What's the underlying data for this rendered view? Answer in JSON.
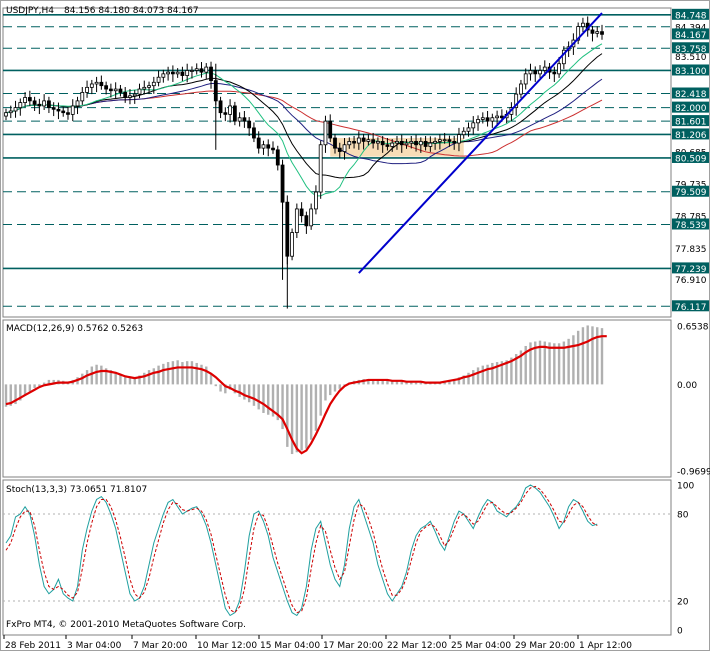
{
  "header": {
    "symbol": "USDJPY,H4",
    "ohlc": "84.156 84.180 84.073 84.167"
  },
  "macd_header": "MACD(12,26,9) 0.5762 0.5263",
  "stoch_header": "Stoch(13,3,3) 73.0651 71.8107",
  "copyright": "FxPro MT4, © 2001-2010 MetaQuotes Software Corp.",
  "colors": {
    "background": "#ffffff",
    "up_candle": "#000000",
    "down_candle": "#000000",
    "trendline": "#0000cc",
    "level_line": "#006060",
    "price_box": "#006060",
    "macd_hist": "#b0b0b0",
    "macd_signal": "#dd0000",
    "stoch_main": "#20a0a0",
    "stoch_signal": "#cc0000",
    "ma_red": "#cc3030",
    "ma_navy": "#202080",
    "ma_black": "#000000",
    "ma_green": "#20c080",
    "fill_zone": "#f5d5a5"
  },
  "chart_data": [
    {
      "type": "candlestick",
      "title": "USDJPY,H4",
      "ylim": [
        75.8,
        84.95
      ],
      "y_ticks": [
        "84.748",
        "84.394",
        "84.167",
        "83.758",
        "83.510",
        "83.100",
        "82.418",
        "82.000",
        "81.601",
        "81.206",
        "80.685",
        "80.509",
        "79.735",
        "79.509",
        "78.785",
        "78.539",
        "77.835",
        "77.239",
        "76.910",
        "76.117"
      ],
      "boxed_ticks": [
        "84.748",
        "84.167",
        "83.758",
        "83.100",
        "82.418",
        "82.000",
        "81.601",
        "81.206",
        "80.509",
        "79.509",
        "78.539",
        "77.239",
        "76.117"
      ],
      "x_ticks": [
        "28 Feb 2011",
        "3 Mar 04:00",
        "7 Mar 20:00",
        "10 Mar 12:00",
        "15 Mar 04:00",
        "17 Mar 20:00",
        "22 Mar 12:00",
        "25 Mar 04:00",
        "29 Mar 20:00",
        "1 Apr 12:00"
      ],
      "levels": [
        {
          "price": 84.748,
          "style": "solid"
        },
        {
          "price": 84.394,
          "style": "dashed"
        },
        {
          "price": 83.758,
          "style": "dashed"
        },
        {
          "price": 83.1,
          "style": "solid"
        },
        {
          "price": 82.418,
          "style": "dashed"
        },
        {
          "price": 82.0,
          "style": "dashed"
        },
        {
          "price": 81.601,
          "style": "dashed"
        },
        {
          "price": 81.206,
          "style": "solid"
        },
        {
          "price": 80.509,
          "style": "solid"
        },
        {
          "price": 79.509,
          "style": "dashed"
        },
        {
          "price": 78.539,
          "style": "dashed"
        },
        {
          "price": 77.239,
          "style": "solid"
        },
        {
          "price": 76.117,
          "style": "dashed"
        }
      ],
      "trendline": {
        "from": [
          74,
          77.1
        ],
        "to": [
          125,
          84.8
        ]
      },
      "close": [
        81.85,
        81.9,
        82.0,
        82.15,
        82.3,
        82.2,
        82.1,
        82.05,
        82.2,
        82.0,
        81.95,
        81.9,
        81.85,
        81.8,
        82.05,
        82.2,
        82.45,
        82.6,
        82.7,
        82.75,
        82.65,
        82.55,
        82.5,
        82.55,
        82.45,
        82.3,
        82.35,
        82.4,
        82.55,
        82.6,
        82.65,
        82.75,
        82.9,
        83.0,
        83.05,
        83.0,
        83.05,
        82.95,
        83.1,
        83.1,
        83.15,
        83.05,
        83.2,
        82.8,
        82.2,
        81.85,
        81.8,
        82.05,
        81.6,
        81.7,
        81.6,
        81.4,
        81.1,
        80.8,
        80.9,
        80.8,
        80.75,
        80.3,
        79.2,
        77.6,
        78.3,
        79.0,
        78.8,
        78.5,
        79.0,
        79.5,
        80.9,
        81.6,
        81.1,
        80.8,
        80.7,
        80.9,
        81.0,
        80.95,
        81.1,
        81.0,
        81.05,
        80.95,
        81.0,
        80.9,
        80.85,
        80.95,
        81.0,
        80.9,
        80.95,
        81.0,
        80.9,
        81.0,
        80.85,
        80.95,
        81.0,
        81.05,
        81.05,
        81.0,
        80.95,
        81.2,
        81.3,
        81.4,
        81.55,
        81.65,
        81.7,
        81.6,
        81.7,
        81.75,
        81.7,
        81.8,
        82.0,
        82.4,
        82.7,
        83.0,
        83.1,
        83.0,
        83.1,
        83.2,
        83.05,
        83.0,
        83.3,
        83.7,
        83.8,
        84.0,
        84.4,
        84.5,
        84.3,
        84.2,
        84.25,
        84.17
      ],
      "macd": {
        "ylim": [
          -0.9699,
          0.6538
        ],
        "y_ticks": [
          "0.6538",
          "0.00",
          "-0.9699"
        ],
        "histogram": [
          -0.25,
          -0.24,
          -0.22,
          -0.18,
          -0.12,
          -0.08,
          -0.04,
          -0.02,
          0.02,
          0.05,
          0.05,
          0.05,
          0.04,
          0.02,
          0.05,
          0.08,
          0.12,
          0.16,
          0.2,
          0.22,
          0.21,
          0.18,
          0.16,
          0.14,
          0.11,
          0.08,
          0.07,
          0.07,
          0.1,
          0.13,
          0.16,
          0.18,
          0.21,
          0.23,
          0.25,
          0.26,
          0.27,
          0.25,
          0.26,
          0.26,
          0.24,
          0.22,
          0.2,
          0.12,
          -0.02,
          -0.08,
          -0.1,
          -0.06,
          -0.1,
          -0.14,
          -0.17,
          -0.2,
          -0.24,
          -0.28,
          -0.32,
          -0.34,
          -0.36,
          -0.4,
          -0.5,
          -0.7,
          -0.78,
          -0.76,
          -0.74,
          -0.72,
          -0.62,
          -0.52,
          -0.35,
          -0.18,
          -0.12,
          -0.08,
          -0.05,
          -0.01,
          0.02,
          0.04,
          0.05,
          0.06,
          0.06,
          0.06,
          0.06,
          0.05,
          0.05,
          0.04,
          0.04,
          0.03,
          0.03,
          0.03,
          0.02,
          0.02,
          0.02,
          0.02,
          0.02,
          0.03,
          0.04,
          0.05,
          0.06,
          0.08,
          0.1,
          0.13,
          0.16,
          0.19,
          0.21,
          0.22,
          0.24,
          0.25,
          0.26,
          0.27,
          0.3,
          0.34,
          0.38,
          0.43,
          0.47,
          0.48,
          0.49,
          0.48,
          0.47,
          0.46,
          0.46,
          0.48,
          0.51,
          0.55,
          0.6,
          0.64,
          0.66,
          0.65,
          0.64,
          0.63
        ],
        "signal": [
          -0.22,
          -0.21,
          -0.18,
          -0.15,
          -0.12,
          -0.09,
          -0.06,
          -0.03,
          -0.01,
          0.0,
          0.01,
          0.02,
          0.02,
          0.02,
          0.03,
          0.05,
          0.07,
          0.1,
          0.12,
          0.14,
          0.15,
          0.15,
          0.14,
          0.13,
          0.11,
          0.09,
          0.08,
          0.07,
          0.08,
          0.09,
          0.11,
          0.13,
          0.14,
          0.16,
          0.17,
          0.18,
          0.19,
          0.19,
          0.19,
          0.19,
          0.18,
          0.17,
          0.15,
          0.12,
          0.08,
          0.03,
          -0.02,
          -0.04,
          -0.07,
          -0.09,
          -0.12,
          -0.14,
          -0.16,
          -0.19,
          -0.22,
          -0.26,
          -0.3,
          -0.34,
          -0.39,
          -0.5,
          -0.62,
          -0.72,
          -0.77,
          -0.74,
          -0.66,
          -0.56,
          -0.45,
          -0.33,
          -0.22,
          -0.14,
          -0.07,
          -0.02,
          0.01,
          0.02,
          0.03,
          0.04,
          0.05,
          0.05,
          0.05,
          0.05,
          0.05,
          0.04,
          0.04,
          0.04,
          0.03,
          0.03,
          0.03,
          0.03,
          0.02,
          0.02,
          0.02,
          0.02,
          0.03,
          0.04,
          0.05,
          0.06,
          0.08,
          0.09,
          0.11,
          0.13,
          0.15,
          0.17,
          0.18,
          0.2,
          0.22,
          0.24,
          0.26,
          0.29,
          0.32,
          0.36,
          0.39,
          0.41,
          0.42,
          0.42,
          0.41,
          0.41,
          0.41,
          0.41,
          0.42,
          0.43,
          0.44,
          0.46,
          0.48,
          0.51,
          0.53,
          0.54,
          0.54
        ]
      },
      "stoch": {
        "ylim": [
          0,
          100
        ],
        "y_ticks": [
          "100",
          "80",
          "20",
          "0"
        ],
        "main": [
          60,
          65,
          78,
          80,
          85,
          80,
          65,
          45,
          30,
          25,
          28,
          35,
          25,
          22,
          20,
          30,
          55,
          70,
          82,
          90,
          92,
          88,
          80,
          70,
          55,
          40,
          25,
          20,
          22,
          30,
          45,
          60,
          70,
          80,
          88,
          90,
          85,
          80,
          82,
          84,
          85,
          80,
          72,
          60,
          45,
          30,
          15,
          10,
          12,
          20,
          40,
          65,
          80,
          82,
          75,
          65,
          50,
          40,
          30,
          20,
          12,
          10,
          15,
          30,
          55,
          70,
          75,
          60,
          45,
          35,
          30,
          45,
          70,
          85,
          90,
          80,
          70,
          60,
          45,
          35,
          25,
          20,
          25,
          30,
          40,
          55,
          65,
          70,
          72,
          75,
          68,
          60,
          55,
          65,
          75,
          82,
          80,
          75,
          70,
          78,
          85,
          90,
          88,
          82,
          80,
          78,
          82,
          85,
          90,
          98,
          100,
          98,
          95,
          90,
          85,
          78,
          70,
          75,
          85,
          90,
          88,
          82,
          75,
          72,
          73
        ],
        "signal": [
          55,
          60,
          70,
          78,
          82,
          82,
          72,
          55,
          40,
          30,
          28,
          30,
          28,
          24,
          22,
          26,
          42,
          60,
          74,
          85,
          90,
          90,
          85,
          76,
          64,
          50,
          35,
          25,
          22,
          26,
          36,
          50,
          62,
          74,
          83,
          88,
          87,
          83,
          82,
          83,
          84,
          82,
          76,
          66,
          52,
          38,
          24,
          14,
          12,
          16,
          28,
          50,
          70,
          80,
          79,
          70,
          58,
          46,
          36,
          26,
          17,
          12,
          13,
          22,
          42,
          60,
          72,
          68,
          55,
          43,
          35,
          40,
          58,
          76,
          87,
          85,
          77,
          67,
          54,
          42,
          32,
          24,
          24,
          28,
          36,
          48,
          60,
          68,
          71,
          73,
          71,
          65,
          58,
          62,
          70,
          78,
          80,
          77,
          73,
          75,
          81,
          87,
          88,
          85,
          82,
          80,
          81,
          84,
          88,
          94,
          98,
          99,
          97,
          93,
          88,
          82,
          75,
          74,
          80,
          86,
          88,
          85,
          79,
          74,
          72
        ]
      }
    }
  ]
}
